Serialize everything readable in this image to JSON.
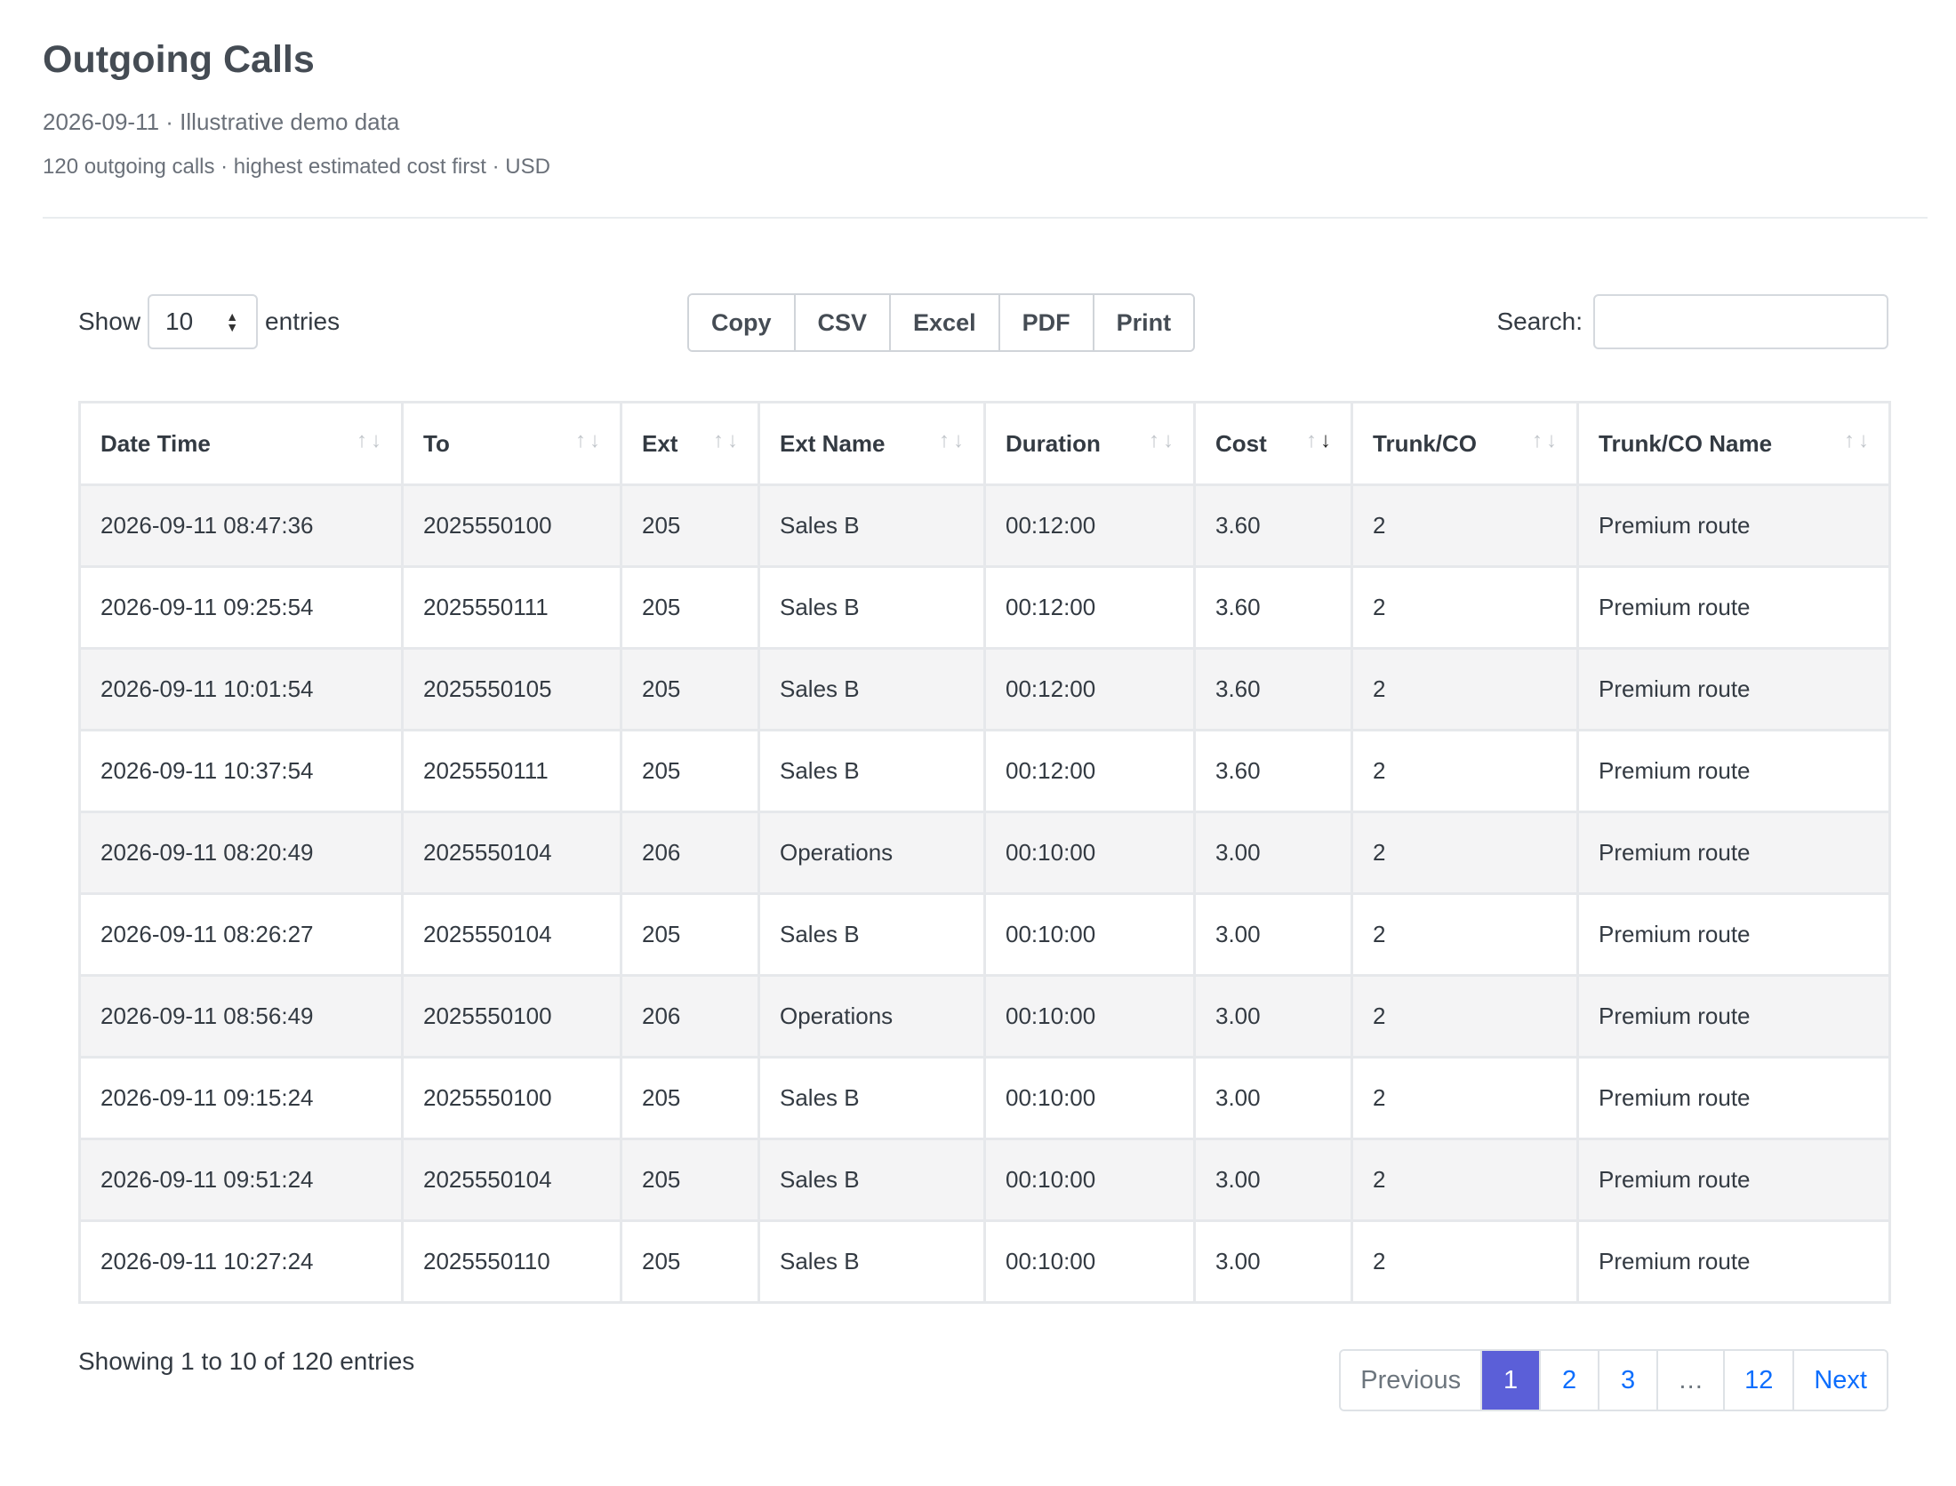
{
  "header": {
    "title": "Outgoing Calls",
    "subtitle": "2026-09-11 · Illustrative demo data",
    "meta": "120 outgoing calls · highest estimated cost first · USD"
  },
  "controls": {
    "show_label": "Show",
    "page_length": "10",
    "entries_label": "entries",
    "buttons": [
      "Copy",
      "CSV",
      "Excel",
      "PDF",
      "Print"
    ],
    "search_label": "Search:",
    "search_value": ""
  },
  "table": {
    "columns": [
      "Date Time",
      "To",
      "Ext",
      "Ext Name",
      "Duration",
      "Cost",
      "Trunk/CO",
      "Trunk/CO Name"
    ],
    "sorted_column": "Cost",
    "sort_direction": "descending",
    "rows": [
      [
        "2026-09-11 08:47:36",
        "2025550100",
        "205",
        "Sales B",
        "00:12:00",
        "3.60",
        "2",
        "Premium route"
      ],
      [
        "2026-09-11 09:25:54",
        "2025550111",
        "205",
        "Sales B",
        "00:12:00",
        "3.60",
        "2",
        "Premium route"
      ],
      [
        "2026-09-11 10:01:54",
        "2025550105",
        "205",
        "Sales B",
        "00:12:00",
        "3.60",
        "2",
        "Premium route"
      ],
      [
        "2026-09-11 10:37:54",
        "2025550111",
        "205",
        "Sales B",
        "00:12:00",
        "3.60",
        "2",
        "Premium route"
      ],
      [
        "2026-09-11 08:20:49",
        "2025550104",
        "206",
        "Operations",
        "00:10:00",
        "3.00",
        "2",
        "Premium route"
      ],
      [
        "2026-09-11 08:26:27",
        "2025550104",
        "205",
        "Sales B",
        "00:10:00",
        "3.00",
        "2",
        "Premium route"
      ],
      [
        "2026-09-11 08:56:49",
        "2025550100",
        "206",
        "Operations",
        "00:10:00",
        "3.00",
        "2",
        "Premium route"
      ],
      [
        "2026-09-11 09:15:24",
        "2025550100",
        "205",
        "Sales B",
        "00:10:00",
        "3.00",
        "2",
        "Premium route"
      ],
      [
        "2026-09-11 09:51:24",
        "2025550104",
        "205",
        "Sales B",
        "00:10:00",
        "3.00",
        "2",
        "Premium route"
      ],
      [
        "2026-09-11 10:27:24",
        "2025550110",
        "205",
        "Sales B",
        "00:10:00",
        "3.00",
        "2",
        "Premium route"
      ]
    ]
  },
  "footer": {
    "info": "Showing 1 to 10 of 120 entries",
    "pagination": {
      "previous": "Previous",
      "pages": [
        "1",
        "2",
        "3",
        "…",
        "12"
      ],
      "active_page": "1",
      "next": "Next"
    }
  },
  "colors": {
    "active_page_bg": "#5b5fd8",
    "link": "#0d6efd",
    "striped_row": "#f4f4f5"
  }
}
